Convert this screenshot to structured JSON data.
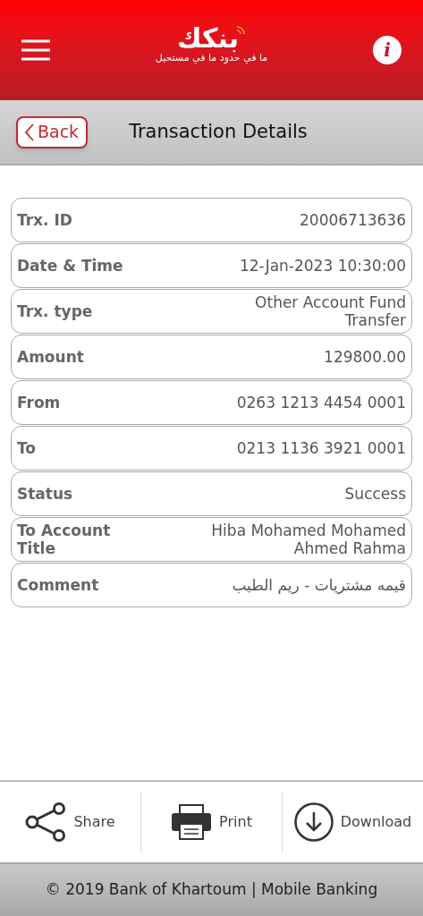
{
  "header": {
    "logo_text": "بنكك",
    "tagline": "ما في حدود ما في مستحيل",
    "info_label": "i"
  },
  "toolbar": {
    "back": "Back",
    "title": "Transaction Details"
  },
  "details": [
    {
      "label": "Trx. ID",
      "value": "20006713636"
    },
    {
      "label": "Date & Time",
      "value": "12-Jan-2023 10:30:00"
    },
    {
      "label": "Trx. type",
      "value": "Other Account Fund Transfer"
    },
    {
      "label": "Amount",
      "value": "129800.00"
    },
    {
      "label": "From",
      "value": "0263 1213 4454 0001"
    },
    {
      "label": "To",
      "value": "0213 1136 3921 0001"
    },
    {
      "label": "Status",
      "value": "Success"
    },
    {
      "label": "To Account Title",
      "value": "Hiba Mohamed Mohamed Ahmed Rahma"
    },
    {
      "label": "Comment",
      "value": "قيمه مشتريات - ريم الطيب"
    }
  ],
  "actions": [
    {
      "kind": "share",
      "label": "Share"
    },
    {
      "kind": "print",
      "label": "Print"
    },
    {
      "kind": "download",
      "label": "Download"
    }
  ],
  "footer": "© 2019 Bank of Khartoum | Mobile Banking"
}
